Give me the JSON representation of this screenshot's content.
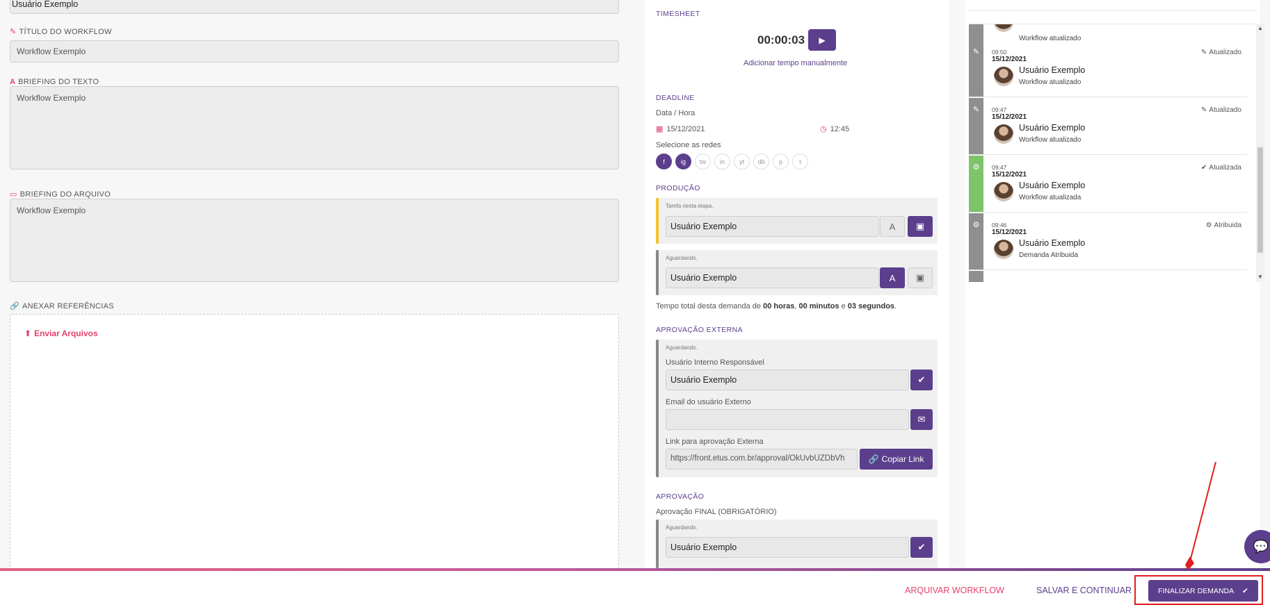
{
  "left": {
    "top_input_value": "Usuário Exemplo",
    "workflow_title_label": "TÍTULO DO WORKFLOW",
    "workflow_title_value": "Workflow Exemplo",
    "text_briefing_label": "BRIEFING DO TEXTO",
    "text_briefing_value": "Workflow Exemplo",
    "file_briefing_label": "BRIEFING DO ARQUIVO",
    "file_briefing_value": "Workflow Exemplo",
    "references_label": "ANEXAR REFERÊNCIAS",
    "send_files": "Enviar Arquivos"
  },
  "middle": {
    "timesheet_title": "TIMESHEET",
    "timer": "00:00:03",
    "add_manual": "Adicionar tempo manualmente",
    "deadline_title": "DEADLINE",
    "date_hour_label": "Data / Hora",
    "date": "15/12/2021",
    "time": "12:45",
    "networks_label": "Selecione as redes",
    "networks": [
      "f",
      "ig",
      "tw",
      "in",
      "yt",
      "db",
      "p",
      "t"
    ],
    "production_title": "PRODUÇÃO",
    "stage_task": "Tarefa nesta etapa.",
    "waiting": "Aguardando.",
    "prod_user_1": "Usuário Exemplo",
    "prod_user_2": "Usuário Exemplo",
    "total_prefix": "Tempo total desta demanda de ",
    "total_hours": "00 horas",
    "total_sep1": ", ",
    "total_minutes": "00 minutos",
    "total_sep2": " e ",
    "total_seconds": "03 segundos",
    "total_suffix": ".",
    "external_title": "APROVAÇÃO EXTERNA",
    "ext_waiting": "Aguardando.",
    "internal_user_label": "Usuário Interno Responsável",
    "internal_user_value": "Usuário Exemplo",
    "ext_email_label": "Email do usuário Externo",
    "ext_email_value": "",
    "ext_link_label": "Link para aprovação Externa",
    "ext_link_value": "https://front.etus.com.br/approval/OkUvbUZDbVh",
    "copy_link": "Copiar Link",
    "approval_title": "APROVAÇÃO",
    "final_approval_label": "Aprovação FINAL (OBRIGATÓRIO)",
    "approval_waiting": "Aguardando.",
    "approval_user": "Usuário Exemplo"
  },
  "history": {
    "top_partial": "Workflow atualizado",
    "items": [
      {
        "time": "09:50",
        "date": "15/12/2021",
        "name": "Usuário Exemplo",
        "desc": "Workflow atualizado",
        "action": "Atualizado",
        "kind": "edit"
      },
      {
        "time": "09:47",
        "date": "15/12/2021",
        "name": "Usuário Exemplo",
        "desc": "Workflow atualizado",
        "action": "Atualizado",
        "kind": "edit"
      },
      {
        "time": "09:47",
        "date": "15/12/2021",
        "name": "Usuário Exemplo",
        "desc": "Workflow atualizada",
        "action": "Atualizada",
        "kind": "check"
      },
      {
        "time": "09:46",
        "date": "15/12/2021",
        "name": "Usuário Exemplo",
        "desc": "Demanda Atribuida",
        "action": "Atribuida",
        "kind": "gear"
      }
    ]
  },
  "footer": {
    "archive": "ARQUIVAR WORKFLOW",
    "save_continue": "SALVAR E CONTINUAR",
    "finish": "FINALIZAR DEMANDA"
  },
  "colors": {
    "primary": "#5b3f8c",
    "accent": "#e5406d",
    "highlight": "#e01e1e",
    "yellow_bar": "#f2c230",
    "green_bar": "#7ec46b"
  }
}
